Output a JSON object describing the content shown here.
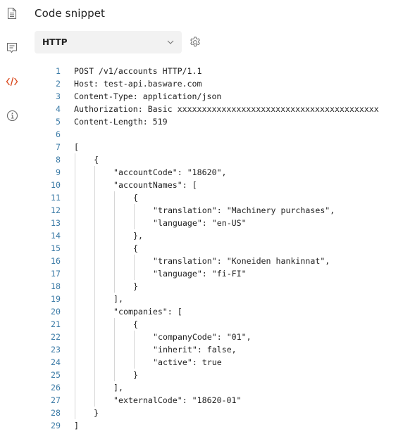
{
  "sidebar": {
    "items": [
      {
        "icon": "document-icon",
        "active": false
      },
      {
        "icon": "comment-icon",
        "active": false
      },
      {
        "icon": "code-icon",
        "active": true
      },
      {
        "icon": "info-icon",
        "active": false
      }
    ],
    "active_color": "#d9481c",
    "inactive_color": "#6b6b6b"
  },
  "panel": {
    "title": "Code snippet",
    "language_select": {
      "value": "HTTP"
    },
    "settings_icon": "gear-icon"
  },
  "code": {
    "lines": [
      {
        "n": "1",
        "indent": 0,
        "text": "POST /v1/accounts HTTP/1.1"
      },
      {
        "n": "2",
        "indent": 0,
        "text": "Host: test-api.basware.com"
      },
      {
        "n": "3",
        "indent": 0,
        "text": "Content-Type: application/json"
      },
      {
        "n": "4",
        "indent": 0,
        "text": "Authorization: Basic xxxxxxxxxxxxxxxxxxxxxxxxxxxxxxxxxxxxxxxxx"
      },
      {
        "n": "5",
        "indent": 0,
        "text": "Content-Length: 519"
      },
      {
        "n": "6",
        "indent": 0,
        "text": ""
      },
      {
        "n": "7",
        "indent": 0,
        "text": "["
      },
      {
        "n": "8",
        "indent": 1,
        "text": "{"
      },
      {
        "n": "9",
        "indent": 2,
        "text": "\"accountCode\": \"18620\","
      },
      {
        "n": "10",
        "indent": 2,
        "text": "\"accountNames\": ["
      },
      {
        "n": "11",
        "indent": 3,
        "text": "{"
      },
      {
        "n": "12",
        "indent": 4,
        "text": "\"translation\": \"Machinery purchases\","
      },
      {
        "n": "13",
        "indent": 4,
        "text": "\"language\": \"en-US\""
      },
      {
        "n": "14",
        "indent": 3,
        "text": "},"
      },
      {
        "n": "15",
        "indent": 3,
        "text": "{"
      },
      {
        "n": "16",
        "indent": 4,
        "text": "\"translation\": \"Koneiden hankinnat\","
      },
      {
        "n": "17",
        "indent": 4,
        "text": "\"language\": \"fi-FI\""
      },
      {
        "n": "18",
        "indent": 3,
        "text": "}"
      },
      {
        "n": "19",
        "indent": 2,
        "text": "],"
      },
      {
        "n": "20",
        "indent": 2,
        "text": "\"companies\": ["
      },
      {
        "n": "21",
        "indent": 3,
        "text": "{"
      },
      {
        "n": "22",
        "indent": 4,
        "text": "\"companyCode\": \"01\","
      },
      {
        "n": "23",
        "indent": 4,
        "text": "\"inherit\": false,"
      },
      {
        "n": "24",
        "indent": 4,
        "text": "\"active\": true"
      },
      {
        "n": "25",
        "indent": 3,
        "text": "}"
      },
      {
        "n": "26",
        "indent": 2,
        "text": "],"
      },
      {
        "n": "27",
        "indent": 2,
        "text": "\"externalCode\": \"18620-01\""
      },
      {
        "n": "28",
        "indent": 1,
        "text": "}"
      },
      {
        "n": "29",
        "indent": 0,
        "text": "]"
      }
    ]
  }
}
